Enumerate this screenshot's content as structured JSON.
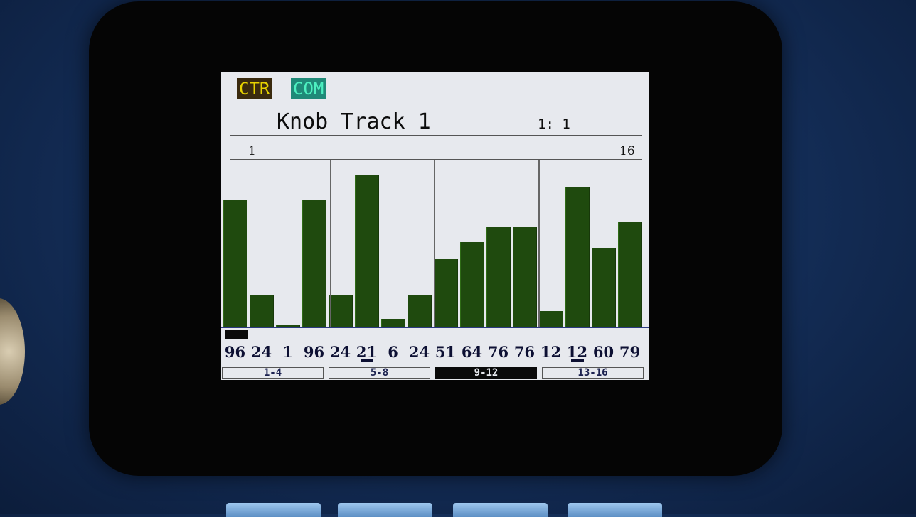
{
  "header": {
    "tag_ctr": "CTR",
    "tag_com": "COM"
  },
  "title": "Knob Track 1",
  "position": "1: 1",
  "ruler": {
    "first": "1",
    "last": "16"
  },
  "steps": [
    {
      "value": "96",
      "level": 96
    },
    {
      "value": "24",
      "level": 24
    },
    {
      "value": "1",
      "level": 1
    },
    {
      "value": "96",
      "level": 96
    },
    {
      "value": "24",
      "level": 24
    },
    {
      "value": "21",
      "level": 115
    },
    {
      "value": "6",
      "level": 6
    },
    {
      "value": "24",
      "level": 24
    },
    {
      "value": "51",
      "level": 51
    },
    {
      "value": "64",
      "level": 64
    },
    {
      "value": "76",
      "level": 76
    },
    {
      "value": "76",
      "level": 76
    },
    {
      "value": "12",
      "level": 12
    },
    {
      "value": "12",
      "level": 106
    },
    {
      "value": "60",
      "level": 60
    },
    {
      "value": "79",
      "level": 79
    }
  ],
  "underlined_steps": [
    5,
    13
  ],
  "selected_step": 0,
  "pages": [
    {
      "label": "1-4",
      "active": false
    },
    {
      "label": "5-8",
      "active": false
    },
    {
      "label": "9-12",
      "active": true
    },
    {
      "label": "13-16",
      "active": false
    }
  ],
  "colors": {
    "bar": "#1f4a0e",
    "screen": "#e7e9ee",
    "tag_ctr_bg": "#3a2a0e",
    "tag_com_bg": "#1f8a78"
  }
}
